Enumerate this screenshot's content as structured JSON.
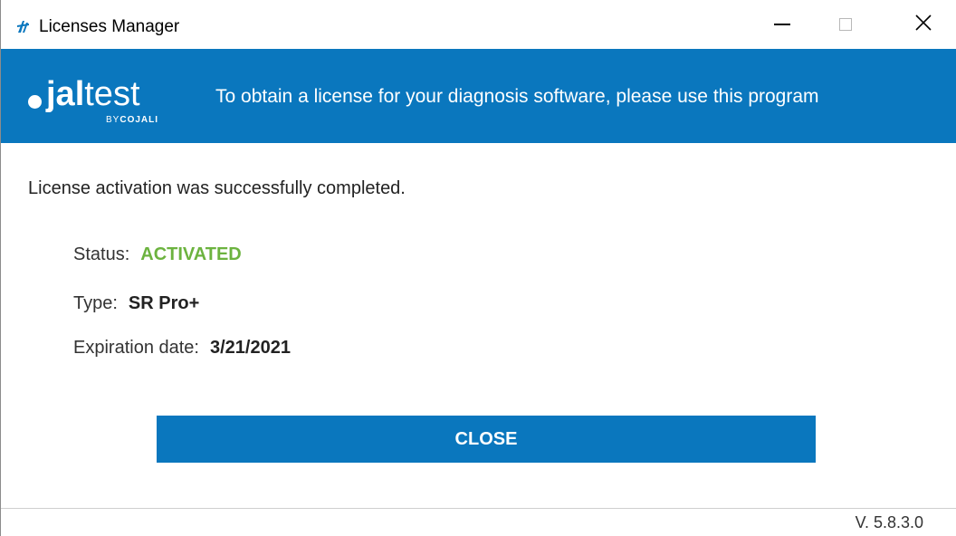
{
  "window": {
    "title": "Licenses Manager",
    "controls": {
      "minimize": "minimize",
      "maximize": "maximize",
      "close": "close"
    }
  },
  "banner": {
    "logo_bold": "jal",
    "logo_light": "test",
    "logo_by": "BY",
    "logo_brand": "COJALI",
    "tagline": "To obtain a license for your diagnosis software, please use this program"
  },
  "content": {
    "message": "License activation was successfully completed.",
    "status_label": "Status:",
    "status_value": "ACTIVATED",
    "type_label": "Type:",
    "type_value": "SR Pro+",
    "expiration_label": "Expiration date:",
    "expiration_value": "3/21/2021"
  },
  "actions": {
    "close_label": "CLOSE"
  },
  "footer": {
    "version": "V. 5.8.3.0"
  },
  "colors": {
    "brand_blue": "#0a77be",
    "status_green": "#6cb33f"
  },
  "icons": {
    "app": "jaltest-app-icon",
    "minimize": "minimize-icon",
    "maximize": "maximize-icon",
    "close": "close-icon"
  }
}
